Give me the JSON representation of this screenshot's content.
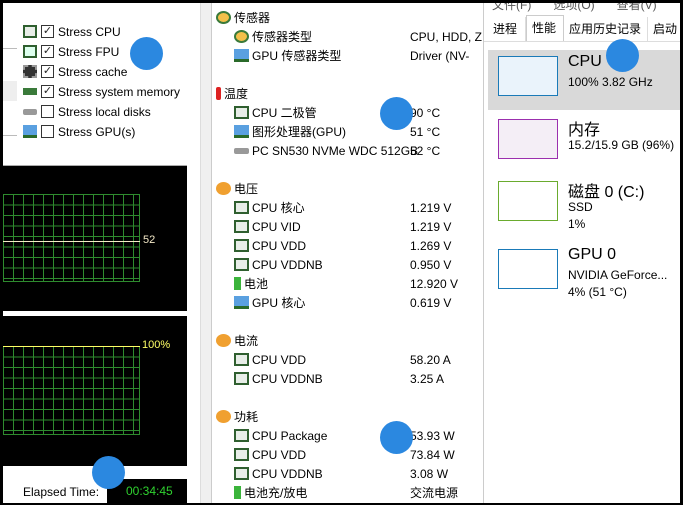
{
  "stress": [
    {
      "label": "Stress CPU",
      "checked": true,
      "icon": "cpu-chip-icon"
    },
    {
      "label": "Stress FPU",
      "checked": true,
      "icon": "fpu-icon"
    },
    {
      "label": "Stress cache",
      "checked": true,
      "icon": "cache-chip-icon"
    },
    {
      "label": "Stress system memory",
      "checked": true,
      "icon": "memory-icon"
    },
    {
      "label": "Stress local disks",
      "checked": false,
      "icon": "disk-icon"
    },
    {
      "label": "Stress GPU(s)",
      "checked": false,
      "icon": "gpu-icon"
    }
  ],
  "graphs": {
    "temp_label": "52",
    "usage_label": "100%"
  },
  "elapsed": {
    "label": "Elapsed Time:",
    "value": "00:34:45"
  },
  "sensors": [
    {
      "label": "传感器",
      "type": "header",
      "icon": "gauge-icon"
    },
    {
      "label": "传感器类型",
      "value": "CPU, HDD, Z",
      "icon": "gauge-icon"
    },
    {
      "label": "GPU 传感器类型",
      "value": "Driver  (NV-",
      "icon": "gpu-icon"
    },
    null,
    {
      "label": "温度",
      "type": "header",
      "icon": "thermometer-icon"
    },
    {
      "label": "CPU 二极管",
      "value": "90 °C",
      "icon": "cpu-chip-icon"
    },
    {
      "label": "图形处理器(GPU)",
      "value": "51 °C",
      "icon": "gpu-icon"
    },
    {
      "label": "PC SN530 NVMe WDC 512GB",
      "value": "52 °C",
      "icon": "disk-icon"
    },
    null,
    {
      "label": "电压",
      "type": "header",
      "icon": "power-icon"
    },
    {
      "label": "CPU 核心",
      "value": "1.219 V",
      "icon": "cpu-chip-icon"
    },
    {
      "label": "CPU VID",
      "value": "1.219 V",
      "icon": "cpu-chip-icon"
    },
    {
      "label": "CPU VDD",
      "value": "1.269 V",
      "icon": "cpu-chip-icon"
    },
    {
      "label": "CPU VDDNB",
      "value": "0.950 V",
      "icon": "cpu-chip-icon"
    },
    {
      "label": "电池",
      "value": "12.920 V",
      "icon": "battery-icon"
    },
    {
      "label": "GPU 核心",
      "value": "0.619 V",
      "icon": "gpu-icon"
    },
    null,
    {
      "label": "电流",
      "type": "header",
      "icon": "power-icon"
    },
    {
      "label": "CPU VDD",
      "value": "58.20 A",
      "icon": "cpu-chip-icon"
    },
    {
      "label": "CPU VDDNB",
      "value": "3.25 A",
      "icon": "cpu-chip-icon"
    },
    null,
    {
      "label": "功耗",
      "type": "header",
      "icon": "power-icon"
    },
    {
      "label": "CPU Package",
      "value": "53.93 W",
      "icon": "cpu-chip-icon"
    },
    {
      "label": "CPU VDD",
      "value": "73.84 W",
      "icon": "cpu-chip-icon"
    },
    {
      "label": "CPU VDDNB",
      "value": "3.08 W",
      "icon": "cpu-chip-icon"
    },
    {
      "label": "电池充/放电",
      "value": "交流电源",
      "icon": "battery-icon"
    }
  ],
  "taskmgr": {
    "menu": [
      "文件(F)",
      "选项(O)",
      "查看(V)"
    ],
    "tabs": [
      "进程",
      "性能",
      "应用历史记录",
      "启动"
    ],
    "active_tab": "性能",
    "items": [
      {
        "name": "CPU",
        "lines": [
          "100% 3.82 GHz"
        ],
        "color": "#1a7ab8",
        "fill": "#eaf3fb",
        "selected": true
      },
      {
        "name": "内存",
        "lines": [
          "15.2/15.9 GB (96%)"
        ],
        "color": "#9b2fae",
        "fill": "#f4eef6",
        "selected": false
      },
      {
        "name": "磁盘 0 (C:)",
        "lines": [
          "SSD",
          "1%"
        ],
        "color": "#6aab2e",
        "fill": "#fff",
        "selected": false
      },
      {
        "name": "GPU 0",
        "lines": [
          "NVIDIA GeForce...",
          "4% (51 °C)"
        ],
        "color": "#1a7ab8",
        "fill": "#fff",
        "selected": false
      }
    ]
  }
}
